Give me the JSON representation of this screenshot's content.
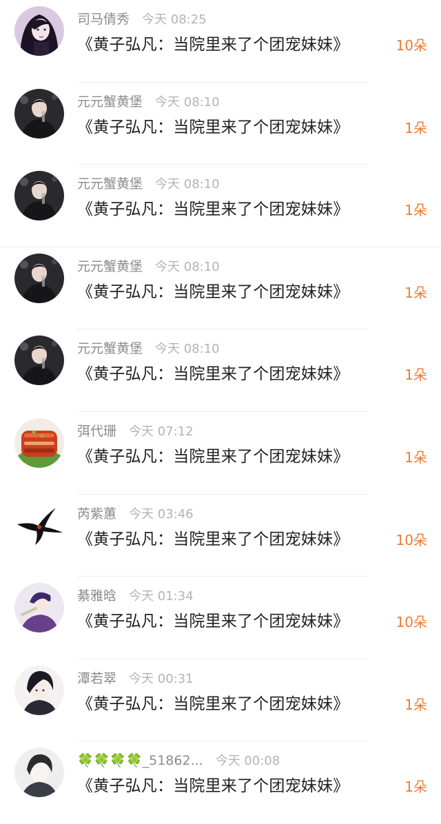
{
  "gift_list": {
    "items": [
      {
        "user": "司马倩秀",
        "time": "今天 08:25",
        "title": "《黄子弘凡：当院里来了个团宠妹妹》",
        "count": "10朵",
        "avatar": "girl-dark-hair-icon"
      },
      {
        "user": "元元蟹黄堡",
        "time": "今天 08:10",
        "title": "《黄子弘凡：当院里来了个团宠妹妹》",
        "count": "1朵",
        "avatar": "singer-microphone-icon"
      },
      {
        "user": "元元蟹黄堡",
        "time": "今天 08:10",
        "title": "《黄子弘凡：当院里来了个团宠妹妹》",
        "count": "1朵",
        "avatar": "singer-microphone-icon"
      },
      {
        "user": "元元蟹黄堡",
        "time": "今天 08:10",
        "title": "《黄子弘凡：当院里来了个团宠妹妹》",
        "count": "1朵",
        "avatar": "singer-microphone-icon"
      },
      {
        "user": "元元蟹黄堡",
        "time": "今天 08:10",
        "title": "《黄子弘凡：当院里来了个团宠妹妹》",
        "count": "1朵",
        "avatar": "singer-microphone-icon"
      },
      {
        "user": "弭代珊",
        "time": "今天 07:12",
        "title": "《黄子弘凡：当院里来了个团宠妹妹》",
        "count": "1朵",
        "avatar": "braised-pork-icon"
      },
      {
        "user": "芮紫蕙",
        "time": "今天 03:46",
        "title": "《黄子弘凡：当院里来了个团宠妹妹》",
        "count": "10朵",
        "avatar": "swallow-bird-icon"
      },
      {
        "user": "綦雅晗",
        "time": "今天 01:34",
        "title": "《黄子弘凡：当院里来了个团宠妹妹》",
        "count": "10朵",
        "avatar": "anime-boy-purple-icon"
      },
      {
        "user": "潭若翠",
        "time": "今天 00:31",
        "title": "《黄子弘凡：当院里来了个团宠妹妹》",
        "count": "1朵",
        "avatar": "anime-boy-dark-icon"
      },
      {
        "user": "🍀🍀🍀🍀_51862...",
        "time": "今天 00:08",
        "title": "《黄子弘凡：当院里来了个团宠妹妹》",
        "count": "1朵",
        "avatar": "anime-boy-sketch-icon"
      }
    ]
  },
  "colors": {
    "count_accent": "#ee7a32",
    "username_gray": "#8b8b8b",
    "time_gray": "#b3b3b3",
    "title_text": "#222222"
  }
}
